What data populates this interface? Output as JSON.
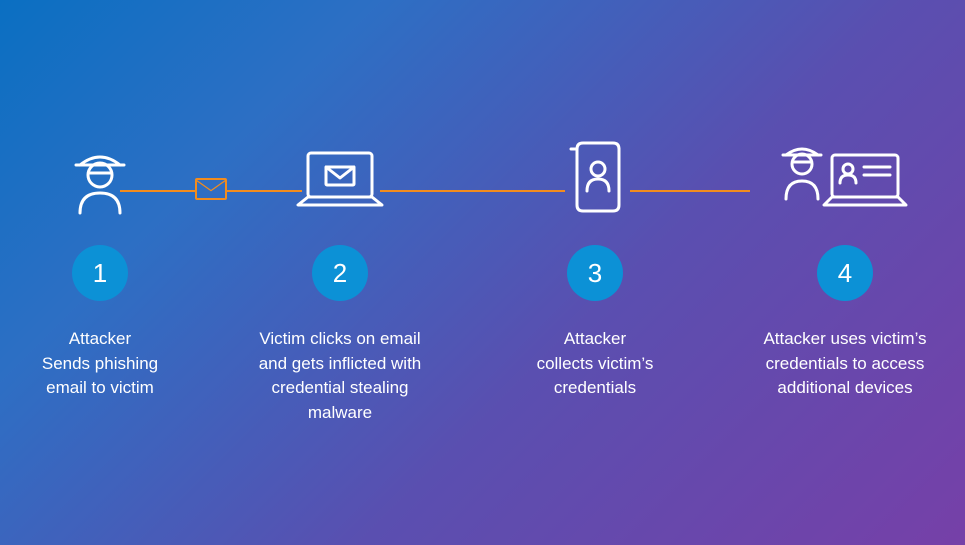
{
  "diagram": {
    "accent_color": "#f28c1e",
    "icon_color": "#ffffff",
    "badge_color": "#0c91d6",
    "steps": [
      {
        "number": "1",
        "description": "Attacker\nSends phishing\nemail to victim",
        "icon": "attacker"
      },
      {
        "number": "2",
        "description": "Victim clicks on email\nand gets inflicted with\ncredential stealing malware",
        "icon": "laptop-mail"
      },
      {
        "number": "3",
        "description": "Attacker\ncollects victim's\ncredentials",
        "icon": "credentials-scroll"
      },
      {
        "number": "4",
        "description": "Attacker uses victim's\ncredentials to access\nadditional devices",
        "icon": "attacker-device"
      }
    ],
    "mid_node_icon": "envelope"
  }
}
